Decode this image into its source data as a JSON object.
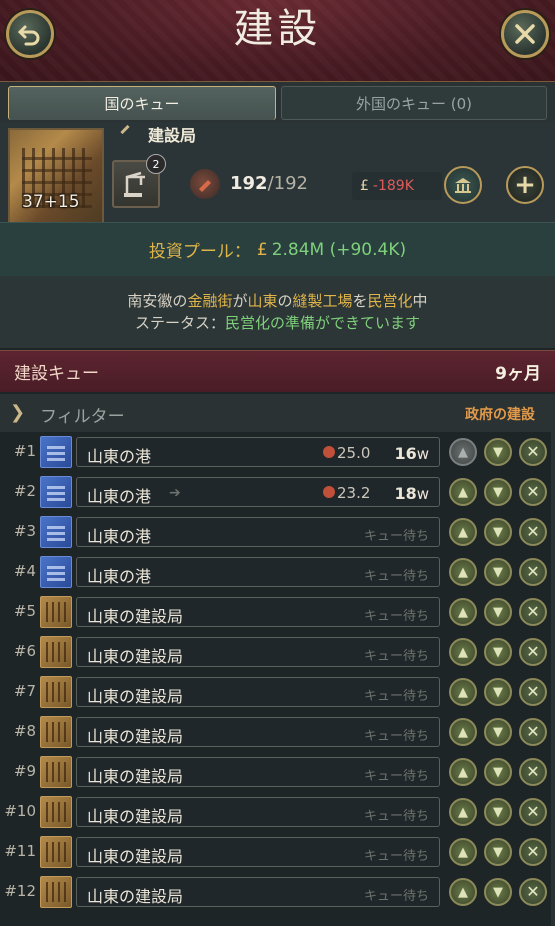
{
  "header": {
    "title": "建設"
  },
  "tabs": [
    {
      "label": "国のキュー",
      "active": true
    },
    {
      "label": "外国のキュー (0)",
      "active": false
    }
  ],
  "building": {
    "name": "建設局",
    "level": "37+15",
    "method_badge": "2",
    "employment": "192",
    "employment_max": "/192",
    "profit_currency": "£",
    "profit": "-189K"
  },
  "investment": {
    "label": "投資プール：",
    "currency": "£",
    "value": "2.84M (+90.4K)"
  },
  "status": {
    "line1_pre": "南安徽の",
    "line1_a": "金融街",
    "line1_b": "が",
    "line1_c": "山東",
    "line1_d": "の",
    "line1_e": "縫製工場",
    "line1_f": "を",
    "line1_g": "民営化",
    "line1_h": "中",
    "line2_label": "ステータス：",
    "line2_value": "民営化の準備ができています"
  },
  "queue": {
    "title": "建設キュー",
    "time": "9ヶ月",
    "filter_label": "フィルター",
    "gov_label": "政府の建設"
  },
  "rows": [
    {
      "num": "#1",
      "type": "port",
      "name": "山東の港",
      "emp": "25.0",
      "weeks": "16",
      "weeks_unit": "w",
      "status": ""
    },
    {
      "num": "#2",
      "type": "port",
      "name": "山東の港",
      "emp": "23.2",
      "weeks": "18",
      "weeks_unit": "w",
      "status": ""
    },
    {
      "num": "#3",
      "type": "port",
      "name": "山東の港",
      "status": "キュー待ち"
    },
    {
      "num": "#4",
      "type": "port",
      "name": "山東の港",
      "status": "キュー待ち"
    },
    {
      "num": "#5",
      "type": "constr",
      "name": "山東の建設局",
      "status": "キュー待ち"
    },
    {
      "num": "#6",
      "type": "constr",
      "name": "山東の建設局",
      "status": "キュー待ち"
    },
    {
      "num": "#7",
      "type": "constr",
      "name": "山東の建設局",
      "status": "キュー待ち"
    },
    {
      "num": "#8",
      "type": "constr",
      "name": "山東の建設局",
      "status": "キュー待ち"
    },
    {
      "num": "#9",
      "type": "constr",
      "name": "山東の建設局",
      "status": "キュー待ち"
    },
    {
      "num": "#10",
      "type": "constr",
      "name": "山東の建設局",
      "status": "キュー待ち"
    },
    {
      "num": "#11",
      "type": "constr",
      "name": "山東の建設局",
      "status": "キュー待ち"
    },
    {
      "num": "#12",
      "type": "constr",
      "name": "山東の建設局",
      "status": "キュー待ち"
    }
  ]
}
